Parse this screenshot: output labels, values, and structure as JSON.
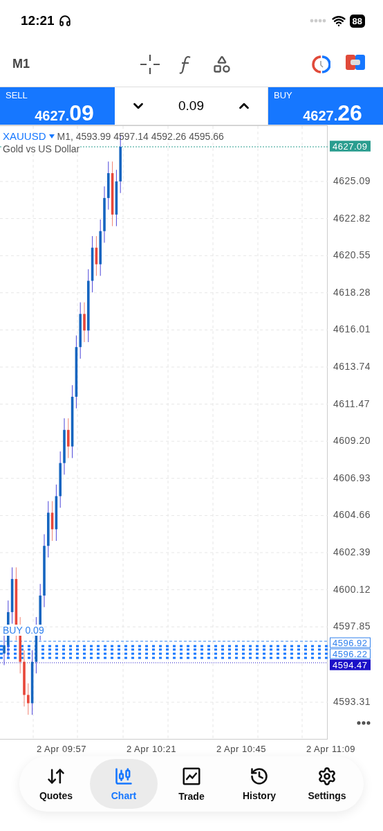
{
  "status_bar": {
    "time": "12:21",
    "battery": "88"
  },
  "toolbar": {
    "timeframe": "M1"
  },
  "trade_bar": {
    "sell": {
      "label": "SELL",
      "price_small": "4627.",
      "price_big": "09"
    },
    "volume": "0.09",
    "buy": {
      "label": "BUY",
      "price_small": "4627.",
      "price_big": "26"
    }
  },
  "chart": {
    "symbol": "XAUUSD",
    "ohlc": "M1, 4593.99 4597.14 4592.26 4595.66",
    "description": "Gold vs US Dollar",
    "order_label": "BUY 0.09",
    "price_ticks": [
      "4625.09",
      "4622.82",
      "4620.55",
      "4618.28",
      "4616.01",
      "4613.74",
      "4611.47",
      "4609.20",
      "4606.93",
      "4604.66",
      "4602.39",
      "4600.12",
      "4597.85",
      "4593.31"
    ],
    "price_markers": [
      {
        "kind": "bid",
        "text": "4627.09",
        "color": "#2a9d8f"
      },
      {
        "kind": "order",
        "text": "4596.92",
        "color": "#2f80ed"
      },
      {
        "kind": "order",
        "text": "4596.22",
        "color": "#2f80ed"
      },
      {
        "kind": "level",
        "text": "4594.47",
        "color": "#1a10c8"
      }
    ],
    "time_ticks": [
      "2 Apr 09:57",
      "2 Apr 10:21",
      "2 Apr 10:45",
      "2 Apr 11:09"
    ]
  },
  "nav": [
    {
      "label": "Quotes",
      "selected": false
    },
    {
      "label": "Chart",
      "selected": true
    },
    {
      "label": "Trade",
      "selected": false
    },
    {
      "label": "History",
      "selected": false
    },
    {
      "label": "Settings",
      "selected": false
    }
  ]
}
